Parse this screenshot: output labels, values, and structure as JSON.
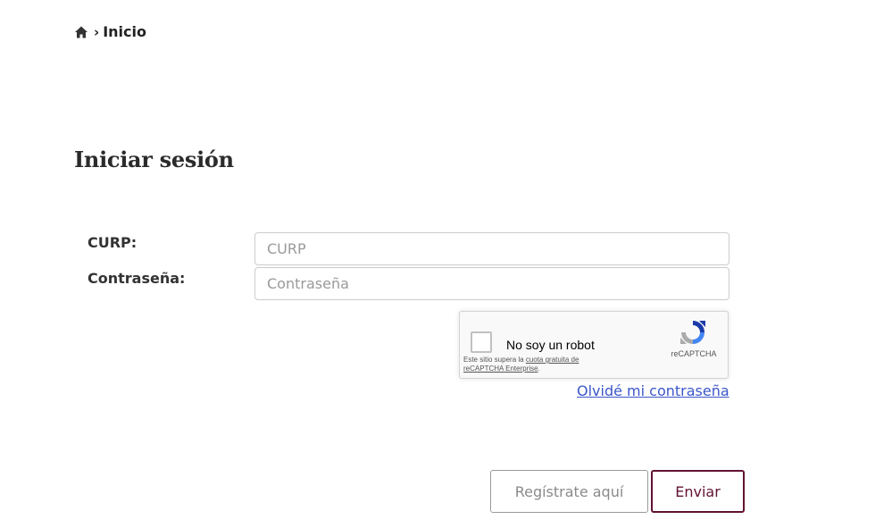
{
  "breadcrumb": {
    "home_icon": "home-icon",
    "separator": "›",
    "current": "Inicio"
  },
  "page": {
    "title": "Iniciar sesión"
  },
  "form": {
    "curp_label": "CURP:",
    "curp_placeholder": "CURP",
    "curp_value": "",
    "password_label": "Contraseña:",
    "password_placeholder": "Contraseña",
    "password_value": ""
  },
  "captcha": {
    "label": "No soy un robot",
    "brand": "reCAPTCHA",
    "notice_prefix": "Este sitio supera la ",
    "notice_link": "cuota gratuita de reCAPTCHA Enterprise",
    "notice_suffix": ".",
    "checked": false
  },
  "links": {
    "forgot_password": "Olvidé mi contraseña"
  },
  "actions": {
    "register_label": "Regístrate aquí",
    "submit_label": "Enviar"
  },
  "colors": {
    "accent": "#611232",
    "link": "#3a56c9",
    "text": "#333333"
  }
}
